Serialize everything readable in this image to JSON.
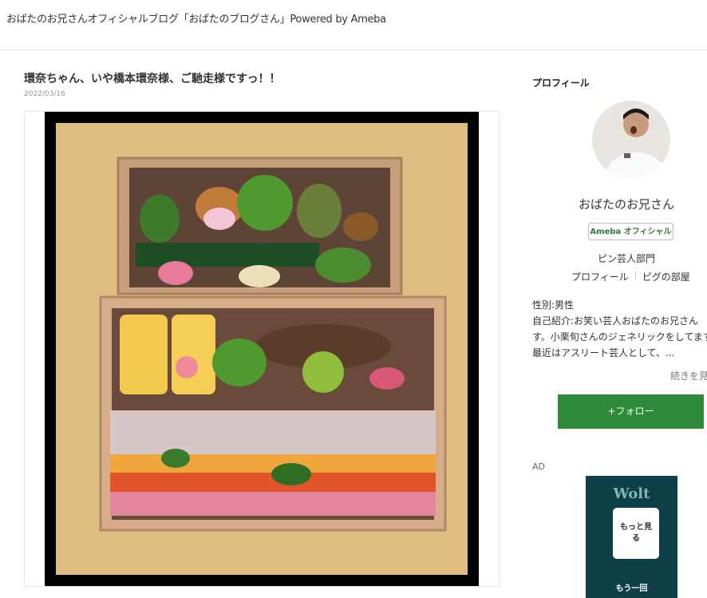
{
  "header": {
    "site_title": "おばたのお兄さんオフィシャルブログ「おばたのブログさん」Powered by Ameba"
  },
  "entry": {
    "title": "環奈ちゃん、いや橋本環奈様、ご馳走様ですっ！！",
    "date": "2022/03/16"
  },
  "sidebar": {
    "heading": "プロフィール",
    "name": "おばたのお兄さん",
    "badge": "Ameba オフィシャル",
    "category": "ピン芸人部門",
    "links": [
      "プロフィール",
      "ピグの部屋"
    ],
    "bio_lines": [
      "性別:男性",
      "自己紹介:お笑い芸人おばたのお兄さん",
      "す。小栗旬さんのジェネリックをしてます",
      "最近はアスリート芸人として、..."
    ],
    "read_more": "続きを見",
    "follow_label": "+フォロー",
    "ad_label": "AD",
    "ad": {
      "brand": "Wolt",
      "more_label": "もっと見る",
      "sub_label": "もう一回"
    }
  },
  "colors": {
    "follow": "#2e8b3c",
    "badge_text": "#2e7d32",
    "ad_bg": "#0e3f47"
  }
}
